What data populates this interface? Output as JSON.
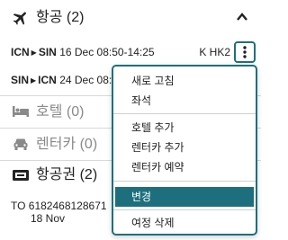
{
  "flights": {
    "title": "항공 (2)",
    "icon": "airplane-icon",
    "segments": [
      {
        "from": "ICN",
        "to": "SIN",
        "details": "16 Dec 08:50-14:25",
        "status": "K HK2"
      },
      {
        "from": "SIN",
        "to": "ICN",
        "details": "24 Dec 08:"
      }
    ]
  },
  "hotel": {
    "title": "호텔 (0)",
    "icon": "bed-icon"
  },
  "car": {
    "title": "렌터카 (0)",
    "icon": "car-icon"
  },
  "ticket": {
    "title": "항공권 (2)",
    "icon": "ticket-icon",
    "number": "TO 6182468128671",
    "date": "18 Nov"
  },
  "menu": {
    "items": [
      "새로 고침",
      "좌석",
      "호텔 추가",
      "렌터카 추가",
      "렌터카 예약",
      "변경",
      "여정 삭제"
    ],
    "active": "변경"
  },
  "colors": {
    "accent": "#1e6f7d",
    "muted": "#8a8a8a"
  }
}
